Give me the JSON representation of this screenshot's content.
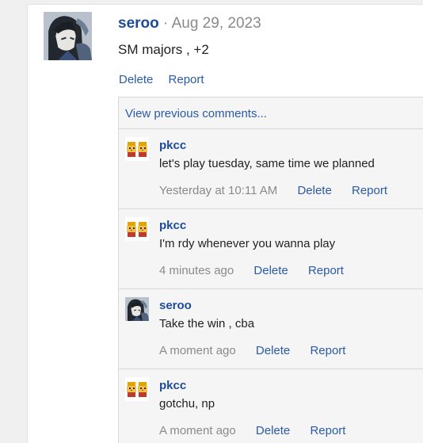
{
  "post": {
    "author": "seroo",
    "separator": "·",
    "date": "Aug 29, 2023",
    "body": "SM majors , +2",
    "actions": {
      "delete": "Delete",
      "report": "Report"
    },
    "avatar_icon": "anime-character-avatar"
  },
  "comments_panel": {
    "view_previous": "View previous comments...",
    "items": [
      {
        "author": "pkcc",
        "text": "let's play tuesday, same time we planned",
        "time": "Yesterday at 10:11 AM",
        "delete": "Delete",
        "report": "Report",
        "avatar_icon": "pixel-character-avatar"
      },
      {
        "author": "pkcc",
        "text": "I'm rdy whenever you wanna play",
        "time": "4 minutes ago",
        "delete": "Delete",
        "report": "Report",
        "avatar_icon": "pixel-character-avatar"
      },
      {
        "author": "seroo",
        "text": "Take the win , cba",
        "time": "A moment ago",
        "delete": "Delete",
        "report": "Report",
        "avatar_icon": "anime-character-avatar"
      },
      {
        "author": "pkcc",
        "text": "gotchu, np",
        "time": "A moment ago",
        "delete": "Delete",
        "report": "Report",
        "avatar_icon": "pixel-character-avatar"
      }
    ]
  },
  "colors": {
    "link": "#2a5aa8",
    "author": "#1d4b9b",
    "muted": "#8a8a8a",
    "panel_bg": "#f5f5f5",
    "page_bg": "#f0f0f0"
  }
}
